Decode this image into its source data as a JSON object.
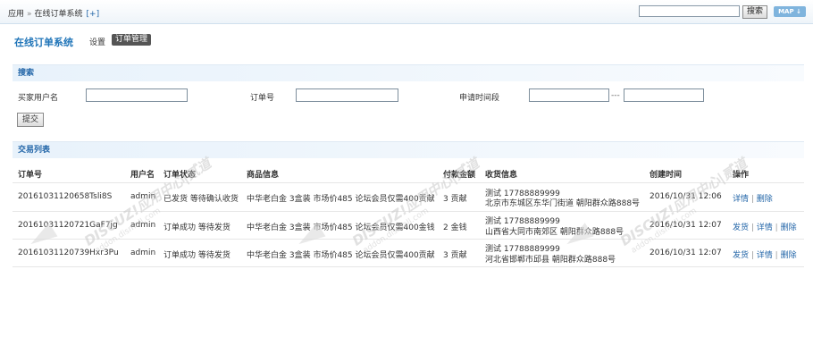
{
  "topbar": {
    "breadcrumb_root": "应用",
    "breadcrumb_sep": "»",
    "breadcrumb_current": "在线订单系统",
    "breadcrumb_add": "[+]",
    "search_value": "",
    "search_button": "搜索",
    "map_button": "MAP ↓"
  },
  "nav": {
    "app_title": "在线订单系统",
    "tabs": [
      {
        "label": "设置",
        "active": false
      },
      {
        "label": "订单管理",
        "active": true
      }
    ]
  },
  "search": {
    "section_title": "搜索",
    "buyer_label": "买家用户名",
    "buyer_value": "",
    "order_no_label": "订单号",
    "order_no_value": "",
    "date_label": "申请时间段",
    "date_from": "",
    "date_range_sep": "---",
    "date_to": "",
    "submit_label": "提交"
  },
  "list": {
    "section_title": "交易列表",
    "columns": [
      "订单号",
      "用户名",
      "订单状态",
      "商品信息",
      "付款金额",
      "收货信息",
      "创建时间",
      "操作"
    ],
    "rows": [
      {
        "order_no": "20161031120658Tsli8S",
        "user": "admin",
        "status": "已发货 等待确认收货",
        "product": "中华老白金 3盒装 市场价485 论坛会员仅需400贡献",
        "amount": "3 贡献",
        "ship_line1": "测试 17788889999",
        "ship_line2": "北京市东城区东华门街道 朝阳群众路888号",
        "created": "2016/10/31 12:06",
        "actions": [
          "详情",
          "删除"
        ]
      },
      {
        "order_no": "20161031120721GaF7jg",
        "user": "admin",
        "status": "订单成功 等待发货",
        "product": "中华老白金 3盒装 市场价485 论坛会员仅需400金钱",
        "amount": "2 金钱",
        "ship_line1": "测试 17788889999",
        "ship_line2": "山西省大同市南郊区 朝阳群众路888号",
        "created": "2016/10/31 12:07",
        "actions": [
          "发货",
          "详情",
          "删除"
        ]
      },
      {
        "order_no": "20161031120739Hxr3Pu",
        "user": "admin",
        "status": "订单成功 等待发货",
        "product": "中华老白金 3盒装 市场价485 论坛会员仅需400贡献",
        "amount": "3 贡献",
        "ship_line1": "测试 17788889999",
        "ship_line2": "河北省邯郸市邱县 朝阳群众路888号",
        "created": "2016/10/31 12:07",
        "actions": [
          "发货",
          "详情",
          "删除"
        ]
      }
    ]
  },
  "watermark": {
    "brand": "DISCUZ!应用中心|贰道",
    "url": "addon.dismall.com"
  },
  "colors": {
    "accent": "#1f74b8",
    "link": "#2366a8",
    "section_bg": "#e8f2fb",
    "active_tab_bg": "#555555",
    "map_button_bg": "#7fb4dd"
  }
}
